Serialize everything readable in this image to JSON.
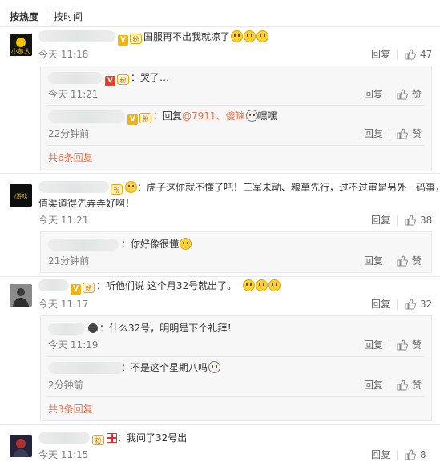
{
  "tabs": [
    {
      "label": "按热度"
    },
    {
      "label": "按时间"
    }
  ],
  "actions": {
    "reply": "回复",
    "like": "赞"
  },
  "comments": [
    {
      "avatar": "小黄人",
      "text": "国服再不出我就凉了",
      "time": "今天 11:18",
      "likes": "47",
      "replies": [
        {
          "text": "哭了…",
          "time": "今天 11:21"
        },
        {
          "reply_prefix": "回复",
          "mention": "@7911",
          "suffix": "、傻缺",
          "text_end": "嘿嘿",
          "time": "22分钟前"
        }
      ],
      "more_replies": "共6条回复"
    },
    {
      "avatar": "/游戏",
      "text_line1": "虎子这你就不懂了吧！三军未动、粮草先行，过不过审是另外一码事，充",
      "text_line2": "值渠道得先弄弄好啊！",
      "time": "今天 11:21",
      "likes": "38",
      "replies": [
        {
          "text": "你好像很懂",
          "time": "21分钟前"
        }
      ]
    },
    {
      "text": "听他们说 这个月32号就出了。",
      "time": "今天 11:17",
      "likes": "32",
      "replies": [
        {
          "text": "什么32号，明明是下个礼拜！",
          "time": "今天 11:19"
        },
        {
          "text": "不是这个星期八吗",
          "time": "2分钟前"
        }
      ],
      "more_replies": "共3条回复"
    },
    {
      "text": "我问了32号出",
      "time": "今天 11:15",
      "likes": "8"
    }
  ]
}
